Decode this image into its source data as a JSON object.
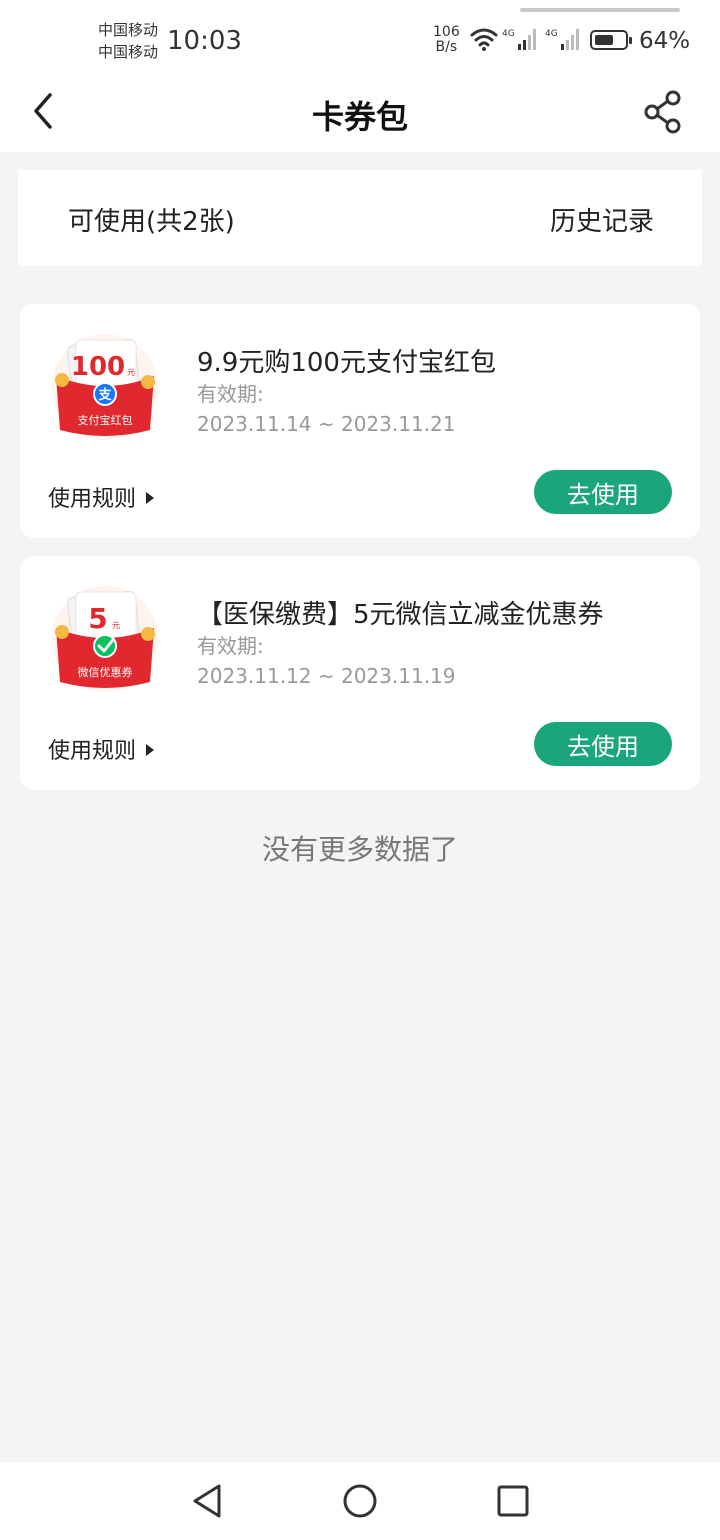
{
  "status_bar": {
    "carrier_1": "中国移动",
    "carrier_2": "中国移动",
    "time": "10:03",
    "net_speed_value": "106",
    "net_speed_unit": "B/s",
    "network_1": "4G",
    "network_2": "4G",
    "battery_percent": "64%",
    "battery_level": 0.64
  },
  "header": {
    "title": "卡券包",
    "back_icon": "chevron-left-icon",
    "share_icon": "share-icon"
  },
  "tabs": {
    "available": "可使用(共2张)",
    "history": "历史记录"
  },
  "coupons": [
    {
      "title": "9.9元购100元支付宝红包",
      "valid_label": "有效期:",
      "valid_range": "2023.11.14 ~ 2023.11.21",
      "rules_label": "使用规则",
      "action_label": "去使用",
      "image_amount": "100",
      "image_unit": "元",
      "image_caption": "支付宝红包",
      "image_badge": "支",
      "badge_color": "#1677ff"
    },
    {
      "title": "【医保缴费】5元微信立减金优惠券",
      "valid_label": "有效期:",
      "valid_range": "2023.11.12 ~ 2023.11.19",
      "rules_label": "使用规则",
      "action_label": "去使用",
      "image_amount": "5",
      "image_unit": "元",
      "image_caption": "微信优惠券",
      "image_badge": "check",
      "badge_color": "#07c160"
    }
  ],
  "footer_message": "没有更多数据了",
  "nav_bar": {
    "back_icon": "triangle-back-icon",
    "home_icon": "circle-home-icon",
    "recent_icon": "square-recent-icon"
  },
  "colors": {
    "accent": "#1aa57a",
    "envelope_red": "#e0282e",
    "background": "#f4f4f4"
  }
}
